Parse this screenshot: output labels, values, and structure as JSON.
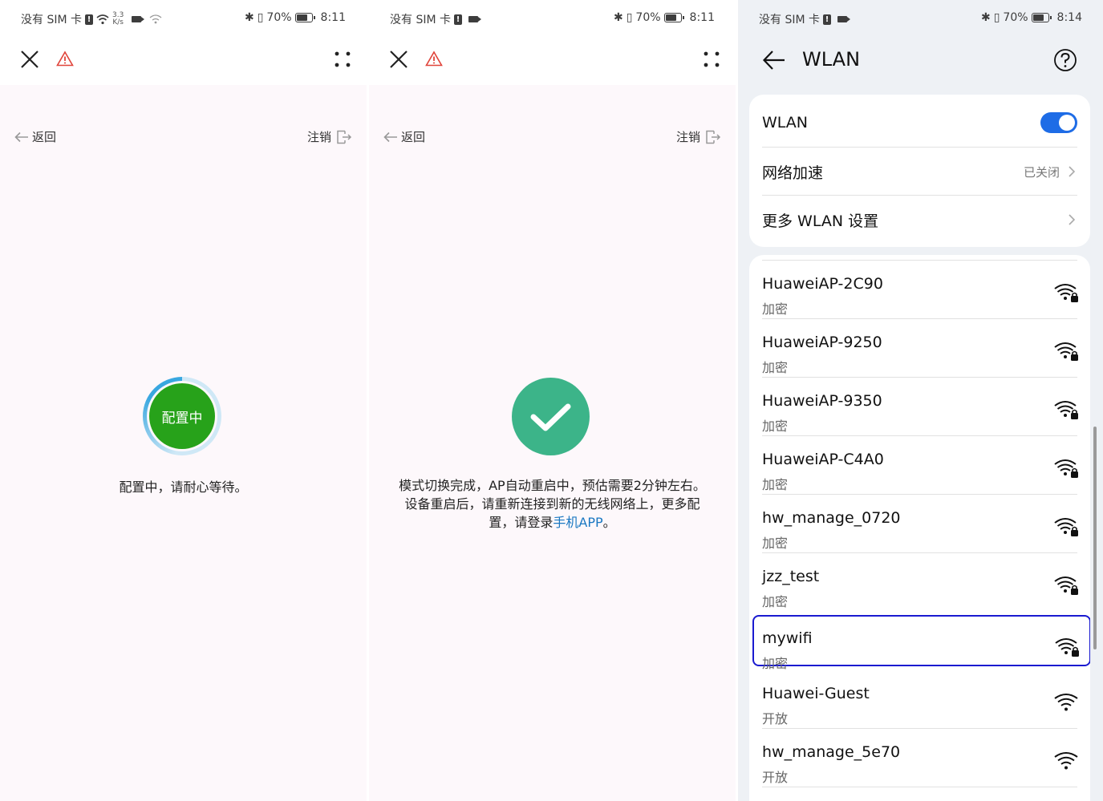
{
  "panel1": {
    "status": {
      "left_text": "没有 SIM 卡",
      "speed_top": "3.3",
      "speed_bottom": "K/s",
      "battery": "70%",
      "time": "8:11"
    },
    "nav": {
      "back_label": "返回",
      "logout_label": "注销"
    },
    "spinner_label": "配置中",
    "message": "配置中，请耐心等待。"
  },
  "panel2": {
    "status": {
      "left_text": "没有 SIM 卡",
      "battery": "70%",
      "time": "8:11"
    },
    "nav": {
      "back_label": "返回",
      "logout_label": "注销"
    },
    "message_line1": "模式切换完成，AP自动重启中，预估需要2分钟左右。",
    "message_line2": "设备重启后，请重新连接到新的无线网络上，更多配",
    "message_line3_prefix": "置，请登录",
    "message_link": "手机APP",
    "message_line3_suffix": "。"
  },
  "panel3": {
    "status": {
      "left_text": "没有 SIM 卡",
      "battery": "70%",
      "time": "8:14"
    },
    "title": "WLAN",
    "settings": {
      "wlan_label": "WLAN",
      "wlan_enabled": true,
      "accel_label": "网络加速",
      "accel_value": "已关闭",
      "more_label": "更多 WLAN 设置"
    },
    "networks": [
      {
        "ssid": "HuaweiAP-2C90",
        "security": "加密"
      },
      {
        "ssid": "HuaweiAP-9250",
        "security": "加密"
      },
      {
        "ssid": "HuaweiAP-9350",
        "security": "加密"
      },
      {
        "ssid": "HuaweiAP-C4A0",
        "security": "加密"
      },
      {
        "ssid": "hw_manage_0720",
        "security": "加密"
      },
      {
        "ssid": "jzz_test",
        "security": "加密"
      },
      {
        "ssid": "mywifi",
        "security": "加密"
      },
      {
        "ssid": "Huawei-Guest",
        "security": "开放"
      },
      {
        "ssid": "hw_manage_5e70",
        "security": "开放"
      }
    ]
  },
  "colors": {
    "accent_blue": "#1e6ce6",
    "spinner_green": "#27a21a",
    "success_green": "#3cb489",
    "link_blue": "#1a78c2",
    "warning_red": "#e0443a",
    "focus_outline": "#1a1ad0"
  },
  "icons": {
    "close": "close-icon",
    "warning": "warning-triangle-icon",
    "more": "more-dots-icon",
    "back": "arrow-left-icon",
    "logout": "logout-icon",
    "help": "help-circle-icon",
    "chevron": "chevron-right-icon",
    "wifi_locked": "wifi-locked-icon",
    "wifi_open": "wifi-icon"
  }
}
